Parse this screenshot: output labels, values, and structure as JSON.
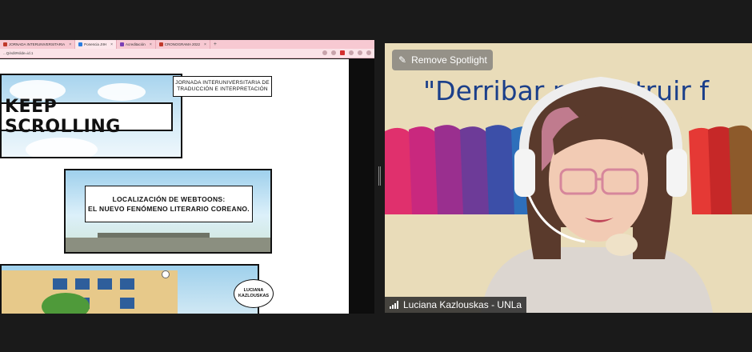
{
  "browser": {
    "tabs": [
      {
        "label": "JORNADA INTERUNIVERSITARIA",
        "active": false,
        "color": "#c0392b"
      },
      {
        "label": "Ponencia JIIH",
        "active": true,
        "color": "#2a7de1"
      },
      {
        "label": "Acreditación",
        "active": false,
        "color": "#7a3fb5"
      },
      {
        "label": "CRONOGRAMA 2022",
        "active": false,
        "color": "#c0392b"
      }
    ],
    "address": "...Q/edit#slide=id.1"
  },
  "slide": {
    "title": "KEEP SCROLLING",
    "event": "JORNADA INTERUNIVERSITARIA DE TRADUCCIÓN E INTERPRETACIÓN",
    "subtitle_line1": "LOCALIZACIÓN DE WEBTOONS:",
    "subtitle_line2": "EL NUEVO FENÓMENO LITERARIO COREANO.",
    "speaker_bubble": "LUCIANA KAZLOUSKAS"
  },
  "video": {
    "spotlight_label": "Remove Spotlight",
    "banner_text": "\"Derribar mit     nstruir f",
    "participant_name": "Luciana Kazlouskas - UNLa",
    "accent": "#1b3f8a"
  }
}
